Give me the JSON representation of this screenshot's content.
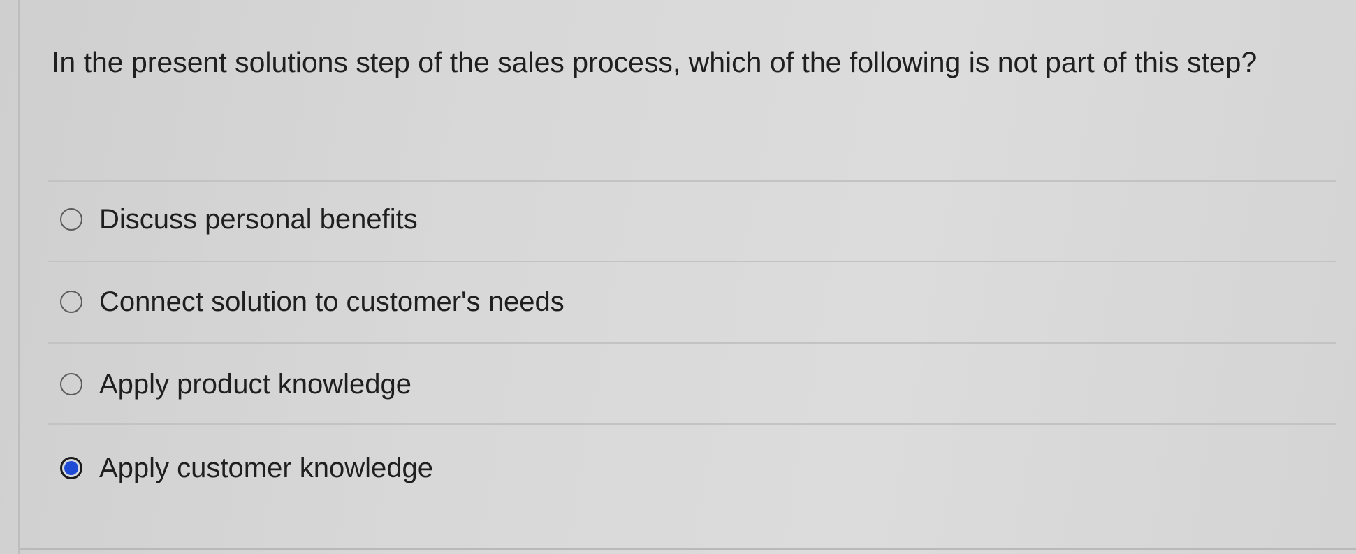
{
  "question": {
    "text": "In the present solutions step of the sales process, which of the following is not part of this step?"
  },
  "options": [
    {
      "label": "Discuss personal benefits",
      "selected": false
    },
    {
      "label": "Connect solution to customer's needs",
      "selected": false
    },
    {
      "label": "Apply product knowledge",
      "selected": false
    },
    {
      "label": "Apply customer knowledge",
      "selected": true
    }
  ],
  "colors": {
    "background": "#d8d8d8",
    "selected_radio": "#1e4bd6",
    "text": "#1f1f1f"
  },
  "icons": {
    "unselected": "radio-unselected-icon",
    "selected": "radio-selected-icon"
  }
}
